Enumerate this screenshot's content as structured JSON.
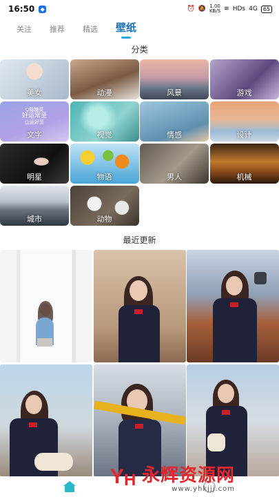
{
  "status_bar": {
    "time": "16:50",
    "speed_value": "1.00",
    "speed_unit": "KB/S",
    "network": "HDs",
    "signal": "4G",
    "battery": "65"
  },
  "tabs": [
    {
      "label": "关注",
      "active": false
    },
    {
      "label": "推荐",
      "active": false
    },
    {
      "label": "精选",
      "active": false
    },
    {
      "label": "壁纸",
      "active": true
    }
  ],
  "categories_title": "分类",
  "categories": [
    {
      "label": "美女"
    },
    {
      "label": "动漫"
    },
    {
      "label": "风景"
    },
    {
      "label": "游戏"
    },
    {
      "label": "文字"
    },
    {
      "label": "视觉"
    },
    {
      "label": "情感"
    },
    {
      "label": "设计"
    },
    {
      "label": "明星"
    },
    {
      "label": "物语"
    },
    {
      "label": "男人"
    },
    {
      "label": "机械"
    },
    {
      "label": "城市"
    },
    {
      "label": "动物"
    }
  ],
  "text_tile": {
    "line1": "Q隐糖菜",
    "line2": "好运常至",
    "line3": "山运好至"
  },
  "recent_title": "最近更新",
  "photos": [
    {
      "name": "photo-1"
    },
    {
      "name": "photo-2"
    },
    {
      "name": "photo-3"
    },
    {
      "name": "photo-4"
    },
    {
      "name": "photo-5"
    },
    {
      "name": "photo-6"
    }
  ],
  "watermark": {
    "title": "永辉资源网",
    "url": "www.yhkjjj.com"
  },
  "colors": {
    "accent": "#1a73b8",
    "tab_indicator": "#2aa7e0",
    "nav_home": "#2bb6c9",
    "watermark": "#e3262d"
  },
  "icons": {
    "nav_home": "home-icon",
    "nav_profile": "profile-icon"
  }
}
